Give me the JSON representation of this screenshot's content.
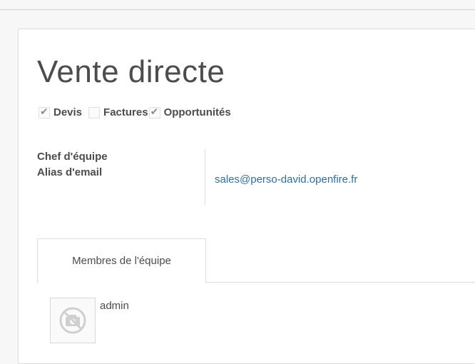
{
  "form": {
    "title": "Vente directe",
    "options": [
      {
        "label": "Devis",
        "checked": true
      },
      {
        "label": "Factures",
        "checked": false
      },
      {
        "label": "Opportunités",
        "checked": true
      }
    ],
    "fields": {
      "team_leader_label": "Chef d'équipe",
      "team_leader_value": "",
      "email_alias_label": "Alias d'email",
      "email_alias_value": "sales@perso-david.openfire.fr"
    },
    "tabs": [
      {
        "label": "Membres de l'équipe",
        "active": true
      }
    ],
    "members": [
      {
        "name": "admin",
        "avatar_icon": "no-photo-icon"
      }
    ]
  },
  "colors": {
    "link": "#2c6fad",
    "text": "#4c4c4c",
    "border": "#dcdcdc"
  }
}
